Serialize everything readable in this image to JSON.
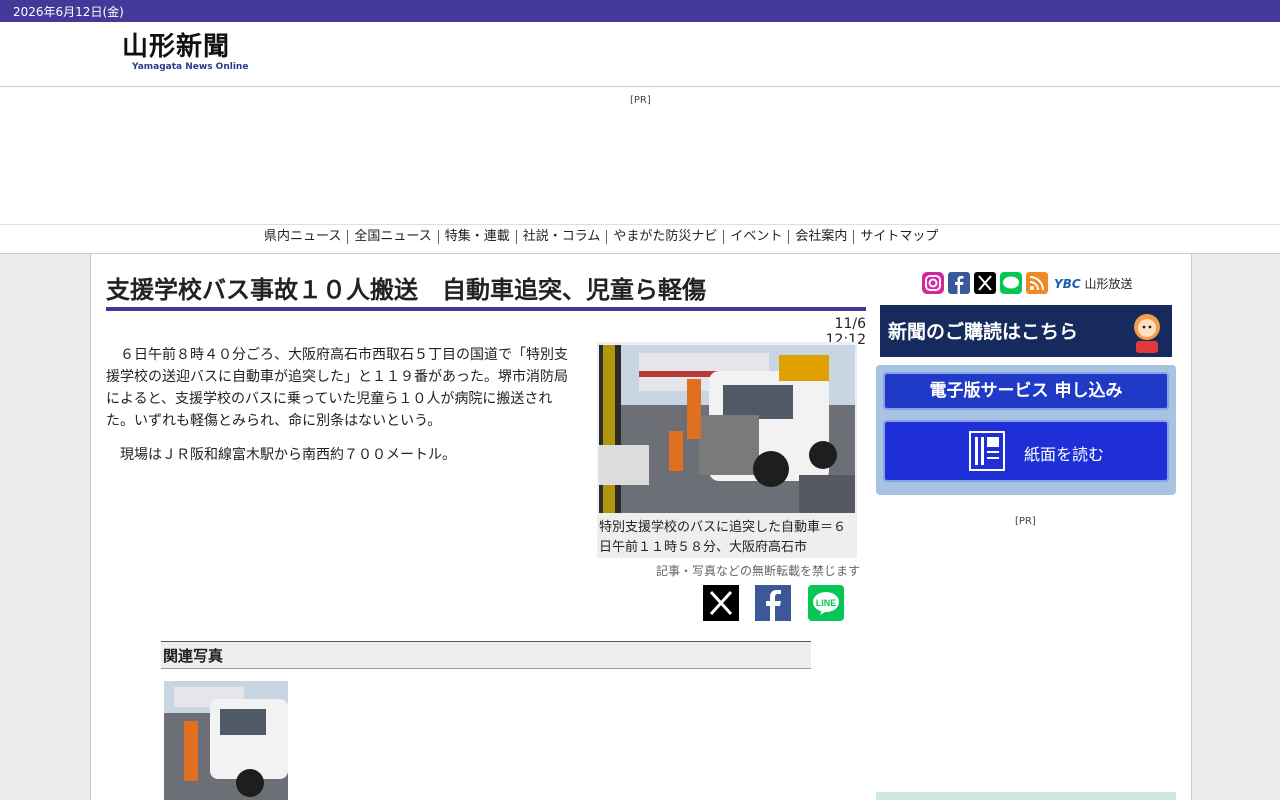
{
  "topbar": {
    "date": "2026年6月12日(金)"
  },
  "header": {
    "logo_text": "山形新聞",
    "logo_sub": "Yamagata News Online"
  },
  "ad": {
    "label": "[PR]"
  },
  "nav": {
    "items": [
      "県内ニュース",
      "全国ニュース",
      "特集・連載",
      "社説・コラム",
      "やまがた防災ナビ",
      "イベント",
      "会社案内",
      "サイトマップ"
    ]
  },
  "article": {
    "title": "支援学校バス事故１０人搬送　自動車追突、児童ら軽傷",
    "date": "11/6 12:12",
    "paragraphs": [
      "６日午前８時４０分ごろ、大阪府高石市西取石５丁目の国道で「特別支援学校の送迎バスに自動車が追突した」と１１９番があった。堺市消防局によると、支援学校のバスに乗っていた児童ら１０人が病院に搬送された。いずれも軽傷とみられ、命に別条はないという。",
      "現場はＪＲ阪和線富木駅から南西約７００メートル。"
    ],
    "photo_caption": "特別支援学校のバスに追突した自動車＝６日午前１１時５８分、大阪府高石市",
    "copyright": "記事・写真などの無断転載を禁じます"
  },
  "related": {
    "heading": "関連写真"
  },
  "sidebar": {
    "broadcaster_logo": "YBC",
    "broadcaster": "山形放送",
    "subscribe_banner": "新聞のご購読はこちら",
    "digital_apply": "電子版サービス 申し込み",
    "read_paper": "紙面を読む",
    "pr_label": "[PR]"
  },
  "colors": {
    "brand": "#43399a",
    "accent_blue": "#1f3ac6",
    "subscribe_bg": "#172a5e"
  }
}
